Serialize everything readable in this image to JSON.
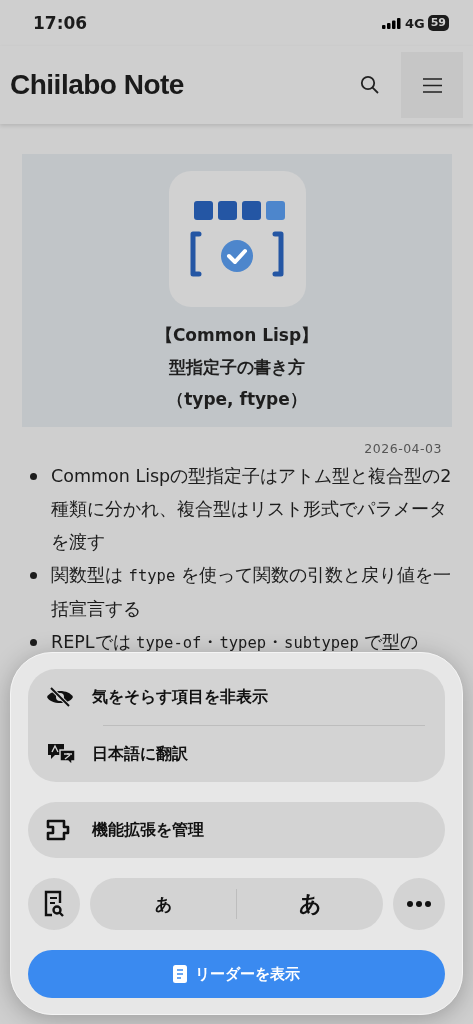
{
  "status_bar": {
    "time": "17:06",
    "network": "4G",
    "battery": "59"
  },
  "header": {
    "title": "Chiilabo Note"
  },
  "article": {
    "hero": {
      "title_lines": [
        "【Common Lisp】",
        "型指定子の書き方",
        "（type, ftype）"
      ]
    },
    "date": "2026-04-03",
    "bullets": [
      [
        {
          "kind": "text",
          "text": "Common Lispの型指定子はアトム型と複合型の2種類に分かれ、複合型はリスト形式でパラメータを渡す"
        }
      ],
      [
        {
          "kind": "text",
          "text": "関数型は "
        },
        {
          "kind": "code",
          "text": "ftype"
        },
        {
          "kind": "text",
          "text": " を使って関数の引数と戻り値を一括宣言する"
        }
      ],
      [
        {
          "kind": "text",
          "text": "REPLでは "
        },
        {
          "kind": "code",
          "text": "type-of"
        },
        {
          "kind": "text",
          "text": "・"
        },
        {
          "kind": "code",
          "text": "typep"
        },
        {
          "kind": "text",
          "text": "・"
        },
        {
          "kind": "code",
          "text": "subtypep"
        },
        {
          "kind": "text",
          "text": " で型の"
        }
      ]
    ]
  },
  "sheet": {
    "groups": [
      {
        "items": [
          {
            "kind": "hide",
            "label": "気をそらす項目を非表示"
          },
          {
            "kind": "translate",
            "label": "日本語に翻訳"
          }
        ]
      },
      {
        "items": [
          {
            "kind": "extension",
            "label": "機能拡張を管理"
          }
        ]
      }
    ],
    "font_size": {
      "smaller": "あ",
      "larger": "あ"
    },
    "reader_button": "リーダーを表示"
  }
}
